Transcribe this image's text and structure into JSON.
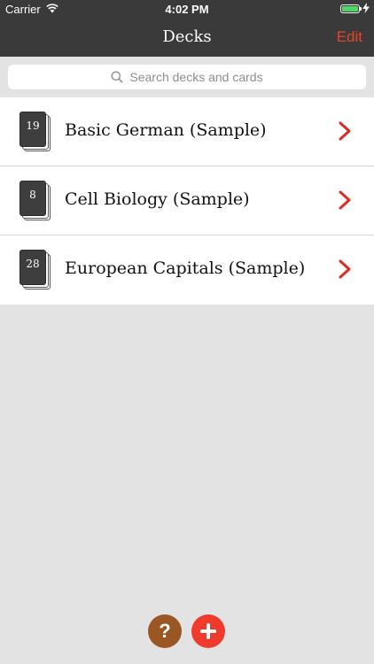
{
  "status_bar": {
    "carrier": "Carrier",
    "time": "4:02 PM"
  },
  "nav": {
    "title": "Decks",
    "edit_label": "Edit"
  },
  "search": {
    "placeholder": "Search decks and cards"
  },
  "decks": [
    {
      "count": "19",
      "name": "Basic German (Sample)"
    },
    {
      "count": "8",
      "name": "Cell Biology (Sample)"
    },
    {
      "count": "28",
      "name": "European Capitals (Sample)"
    }
  ],
  "toolbar": {
    "help_label": "?",
    "add_icon": "plus-icon"
  },
  "colors": {
    "accent": "#e8432c",
    "help": "#9a5623",
    "add": "#ee3b2c",
    "bar": "#3a3a3a"
  }
}
